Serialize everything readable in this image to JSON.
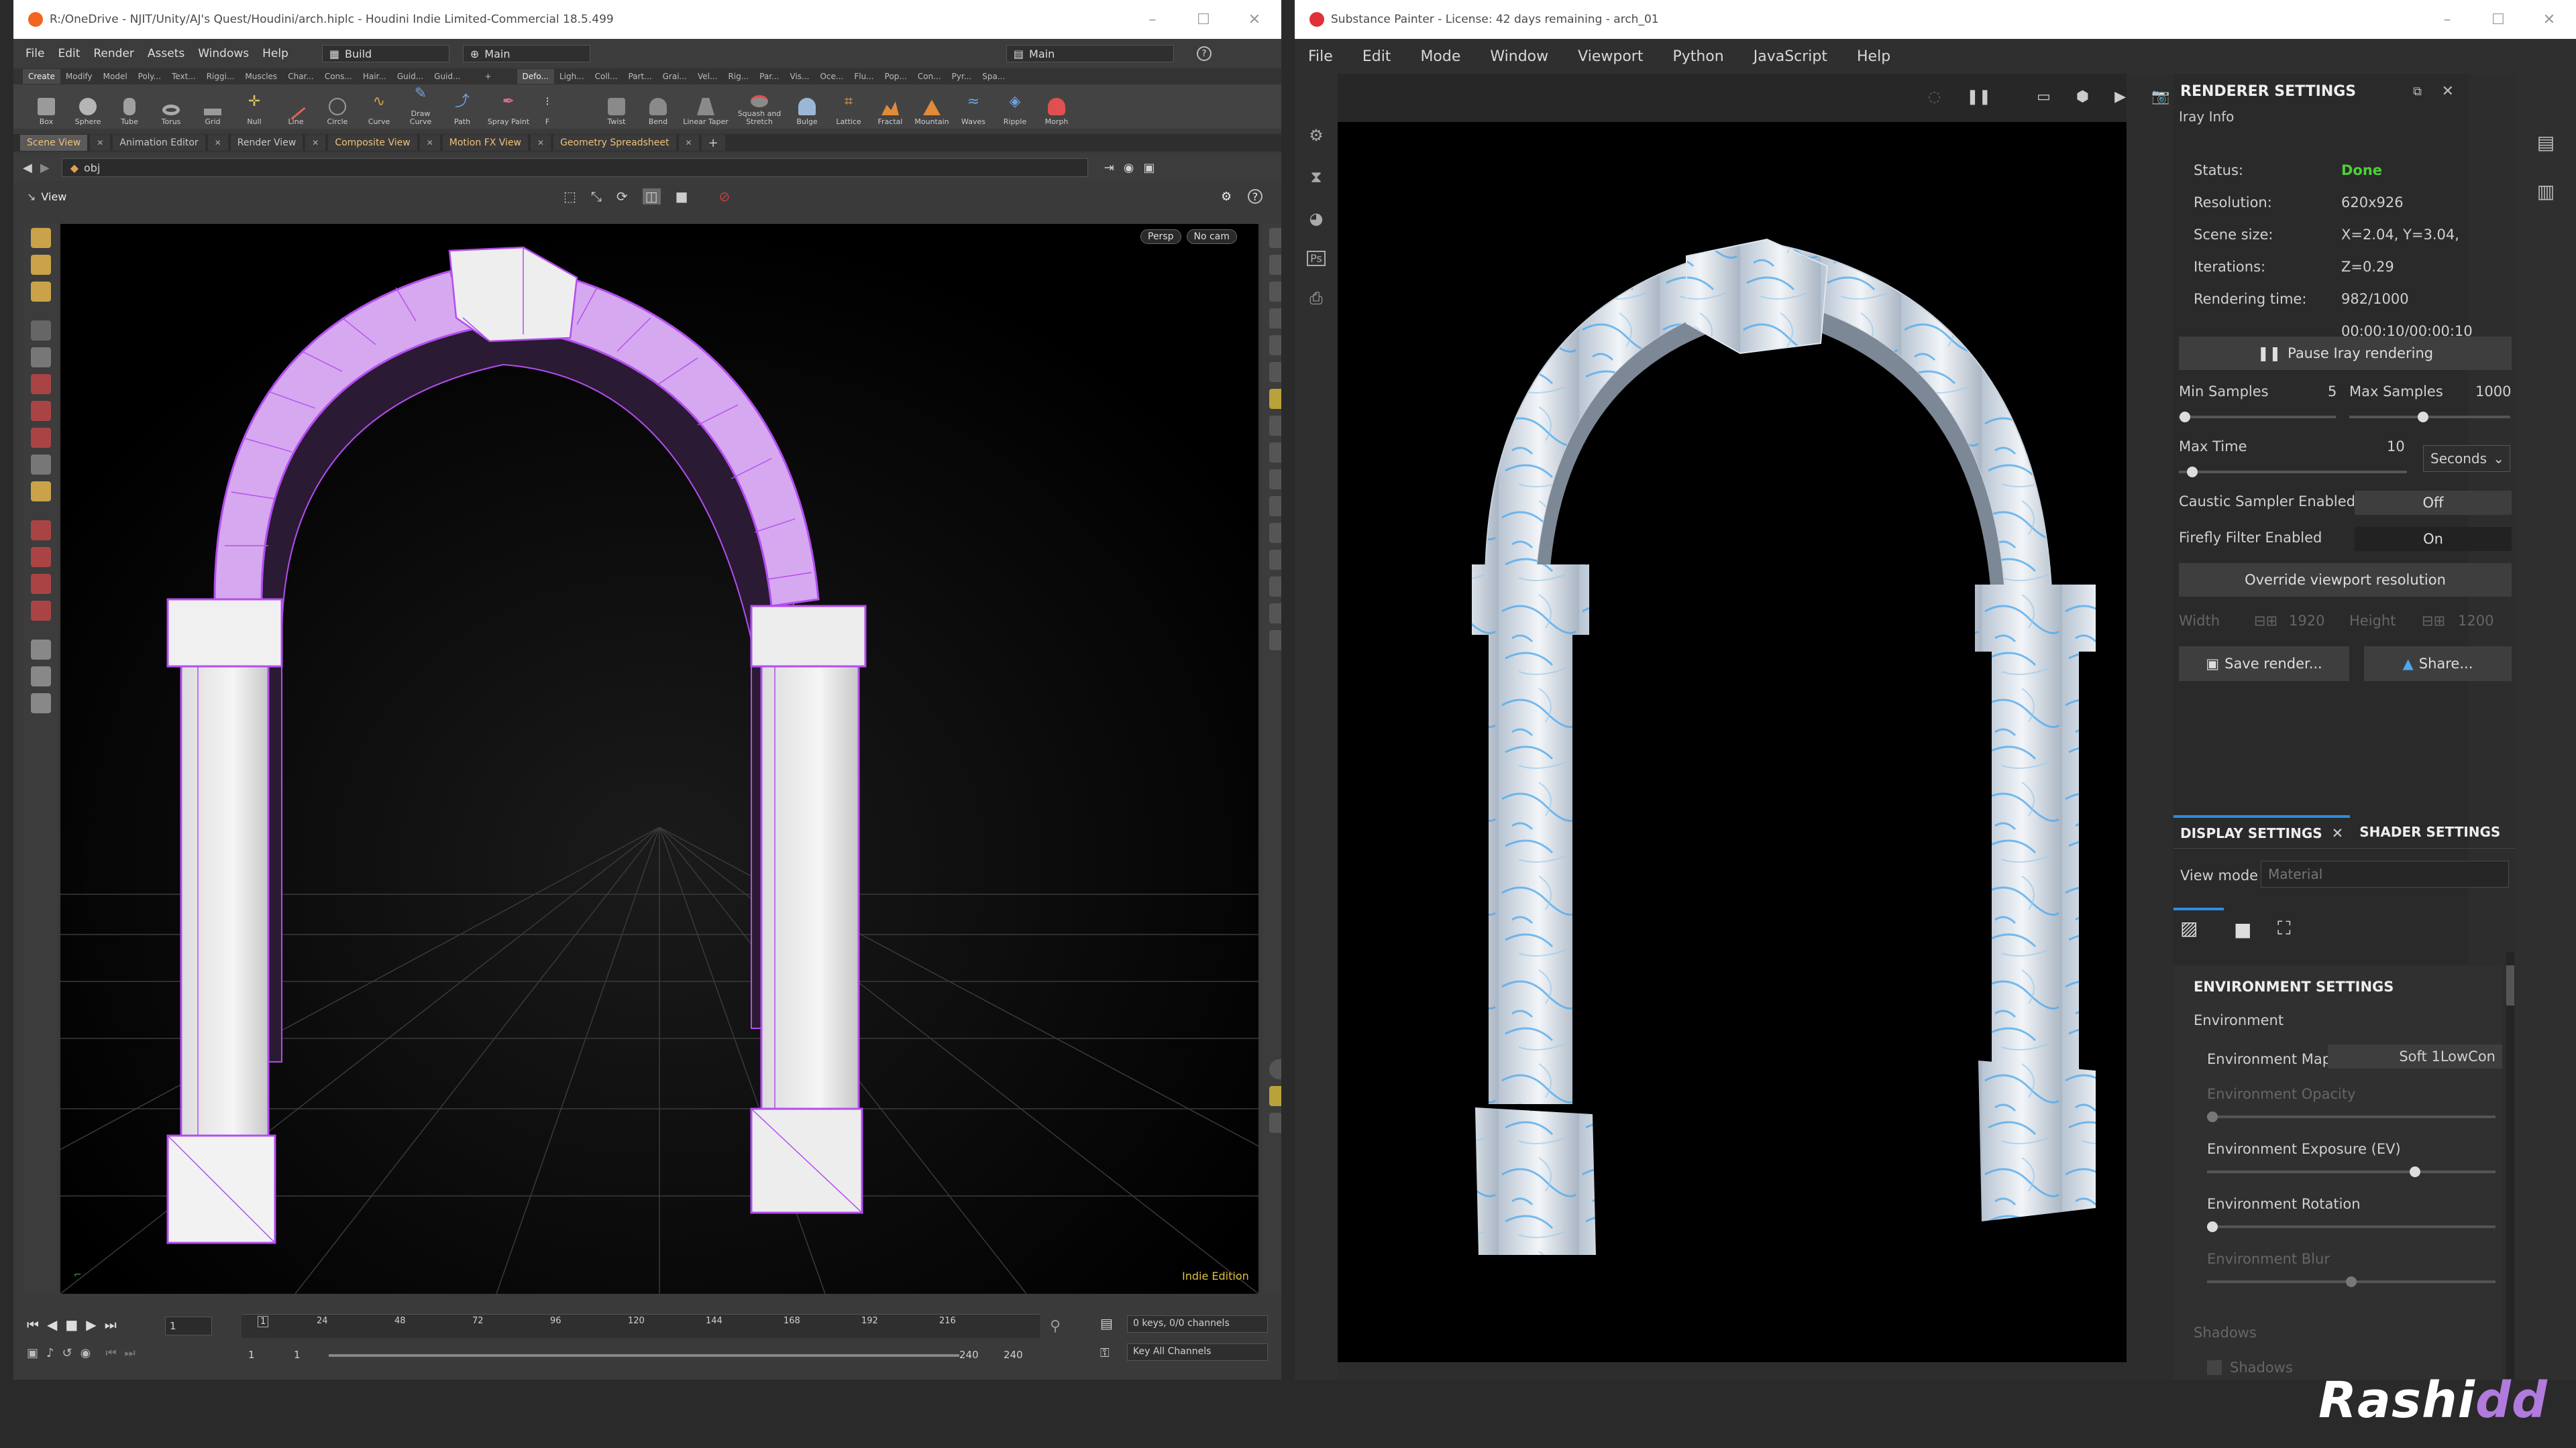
{
  "houdini": {
    "title": "R:/OneDrive - NJIT/Unity/AJ's Quest/Houdini/arch.hiplc - Houdini Indie Limited-Commercial 18.5.499",
    "menu": [
      "File",
      "Edit",
      "Render",
      "Assets",
      "Windows",
      "Help"
    ],
    "desktop": "Build",
    "context": "Main",
    "context_right": "Main",
    "shelf_tabs_left": [
      "Create",
      "Modify",
      "Model",
      "Poly...",
      "Text...",
      "Riggi...",
      "Muscles",
      "Char...",
      "Cons...",
      "Hair...",
      "Guid...",
      "Guid..."
    ],
    "shelf_tabs_right": [
      "Defo...",
      "Ligh...",
      "Coll...",
      "Part...",
      "Grai...",
      "Vel...",
      "Rig...",
      "Par...",
      "Vis...",
      "Oce...",
      "Flu...",
      "Pop...",
      "Con...",
      "Pyr...",
      "Spa..."
    ],
    "tools_left": [
      "Box",
      "Sphere",
      "Tube",
      "Torus",
      "Grid",
      "Null",
      "Line",
      "Circle",
      "Curve",
      "Draw Curve",
      "Path",
      "Spray Paint",
      "F"
    ],
    "tools_right": [
      "Twist",
      "Bend",
      "Linear Taper",
      "Squash and Stretch",
      "Bulge",
      "Lattice",
      "Fractal",
      "Mountain",
      "Waves",
      "Ripple",
      "Morph"
    ],
    "pane_tabs": [
      "Scene View",
      "Animation Editor",
      "Render View",
      "Composite View",
      "Motion FX View",
      "Geometry Spreadsheet"
    ],
    "path": "obj",
    "view_label": "View",
    "persp": "Persp",
    "nocam": "No cam",
    "edition": "Indie Edition",
    "timeline": {
      "frame": "1",
      "ticks": [
        "1",
        "24",
        "48",
        "72",
        "96",
        "120",
        "144",
        "168",
        "192",
        "216"
      ],
      "start": "1",
      "start2": "1",
      "end": "240",
      "end2": "240",
      "keys": "0 keys, 0/0 channels",
      "key_mode": "Key All Channels"
    },
    "accent": "#c88be8"
  },
  "substance": {
    "title": "Substance Painter - License: 42 days remaining - arch_01",
    "menu": [
      "File",
      "Edit",
      "Mode",
      "Window",
      "Viewport",
      "Python",
      "JavaScript",
      "Help"
    ],
    "renderer": {
      "header": "RENDERER SETTINGS",
      "iray_info": "Iray Info",
      "status_label": "Status:",
      "status_value": "Done",
      "resolution_label": "Resolution:",
      "resolution_value": "620x926",
      "scene_label": "Scene size:",
      "scene_value": "X=2.04, Y=3.04, Z=0.29",
      "iter_label": "Iterations:",
      "iter_value": "982/1000",
      "time_label": "Rendering time:",
      "time_value": "00:00:10/00:00:10",
      "pause_btn": "Pause Iray rendering",
      "min_samples_label": "Min Samples",
      "min_samples": "5",
      "min_samples_level": 0.04,
      "max_samples_label": "Max Samples",
      "max_samples": "1000",
      "max_samples_level": 0.46,
      "max_time_label": "Max Time",
      "max_time": "10",
      "max_time_level": 0.06,
      "max_time_unit": "Seconds",
      "caustic_label": "Caustic Sampler Enabled",
      "caustic_value": "Off",
      "firefly_label": "Firefly Filter Enabled",
      "firefly_value": "On",
      "override_btn": "Override viewport resolution",
      "width_label": "Width",
      "width_value": "1920",
      "height_label": "Height",
      "height_value": "1200",
      "save_btn": "Save render...",
      "share_btn": "Share..."
    },
    "display": {
      "tab1": "DISPLAY SETTINGS",
      "tab2": "SHADER SETTINGS",
      "view_mode_label": "View mode",
      "view_mode_placeholder": "Material",
      "env_header": "ENVIRONMENT SETTINGS",
      "environment": "Environment",
      "env_map_label": "Environment Map",
      "env_map_value": "Soft 1LowCon",
      "env_opacity_label": "Environment Opacity",
      "env_opacity_level": 0.0,
      "env_exposure_label": "Environment Exposure (EV)",
      "env_exposure_level": 0.72,
      "env_rotation_label": "Environment Rotation",
      "env_rotation_level": 0.0,
      "env_blur_label": "Environment Blur",
      "env_blur_level": 0.5,
      "shadows_header": "Shadows",
      "shadows_label": "Shadows"
    },
    "status_done_color": "#4cd137"
  },
  "brand": {
    "main": "Rashi",
    "accent": "dd"
  }
}
